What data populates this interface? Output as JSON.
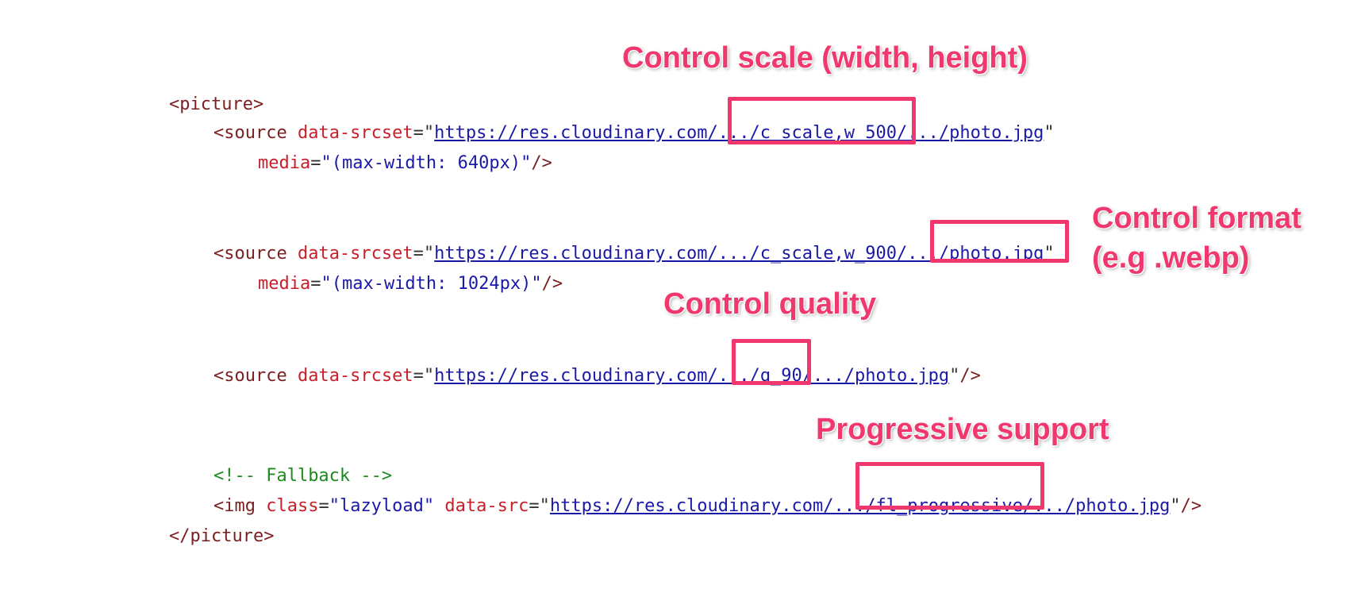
{
  "code": {
    "picture_open": "<picture>",
    "source1": {
      "open": "<source",
      "attr": "data-srcset",
      "url": "https://res.cloudinary.com/.../c_scale,w_500/.../photo.jpg",
      "media_attr": "media",
      "media_val": "\"(max-width: 640px)\"",
      "close": "/>"
    },
    "source2": {
      "open": "<source",
      "attr": "data-srcset",
      "url": "https://res.cloudinary.com/.../c_scale,w_900/.../photo.jpg",
      "media_attr": "media",
      "media_val": "\"(max-width: 1024px)\"",
      "close": "/>"
    },
    "source3": {
      "open": "<source",
      "attr": "data-srcset",
      "url": "https://res.cloudinary.com/.../q_90/.../photo.jpg",
      "close": "/>"
    },
    "comment": "<!-- Fallback -->",
    "img": {
      "open": "<img",
      "class_attr": "class",
      "class_val": "\"lazyload\"",
      "src_attr": "data-src",
      "url": "https://res.cloudinary.com/.../fl_progressive/.../photo.jpg",
      "close": "/>"
    },
    "picture_close": "</picture>"
  },
  "annotations": {
    "scale": "Control scale (width, height)",
    "format_line1": "Control format",
    "format_line2": "(e.g .webp)",
    "quality": "Control quality",
    "progressive": "Progressive support"
  },
  "colors": {
    "highlight": "#f0386e",
    "tag": "#7a1f1f",
    "attribute": "#c8202a",
    "value": "#1a1aa6",
    "comment": "#1f8a1f"
  }
}
